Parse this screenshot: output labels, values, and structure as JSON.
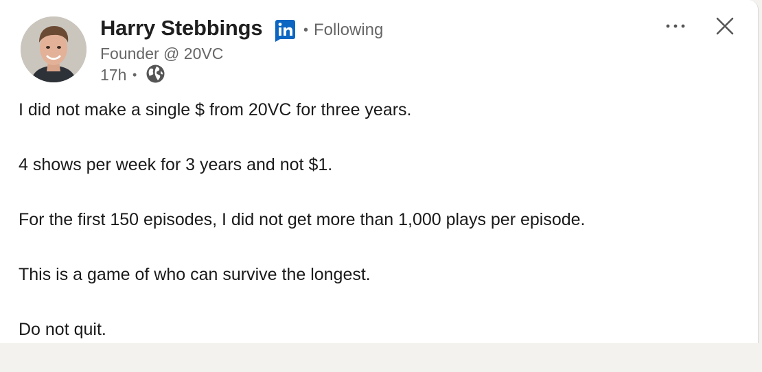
{
  "post": {
    "author": {
      "name": "Harry Stebbings",
      "headline": "Founder @ 20VC",
      "follow_status": "Following",
      "separator": "•",
      "badge_icon": "linkedin-icon",
      "badge_color": "#0a66c2"
    },
    "meta": {
      "timestamp": "17h",
      "separator": "•",
      "visibility_icon": "globe-icon"
    },
    "actions": {
      "more_icon": "more-horizontal-icon",
      "close_icon": "close-icon"
    },
    "body": [
      "I did not make a single $ from 20VC for three years.",
      "4 shows per week for 3 years and not $1.",
      "For the first 150 episodes, I did not get more than 1,000 plays per episode.",
      "This is a game of who can survive the longest.",
      "Do not quit."
    ]
  },
  "colors": {
    "text_primary": "#1f1f1f",
    "text_secondary": "#666666",
    "linkedin_blue": "#0a66c2",
    "card_background": "#ffffff",
    "page_background": "#f3f2ef"
  }
}
